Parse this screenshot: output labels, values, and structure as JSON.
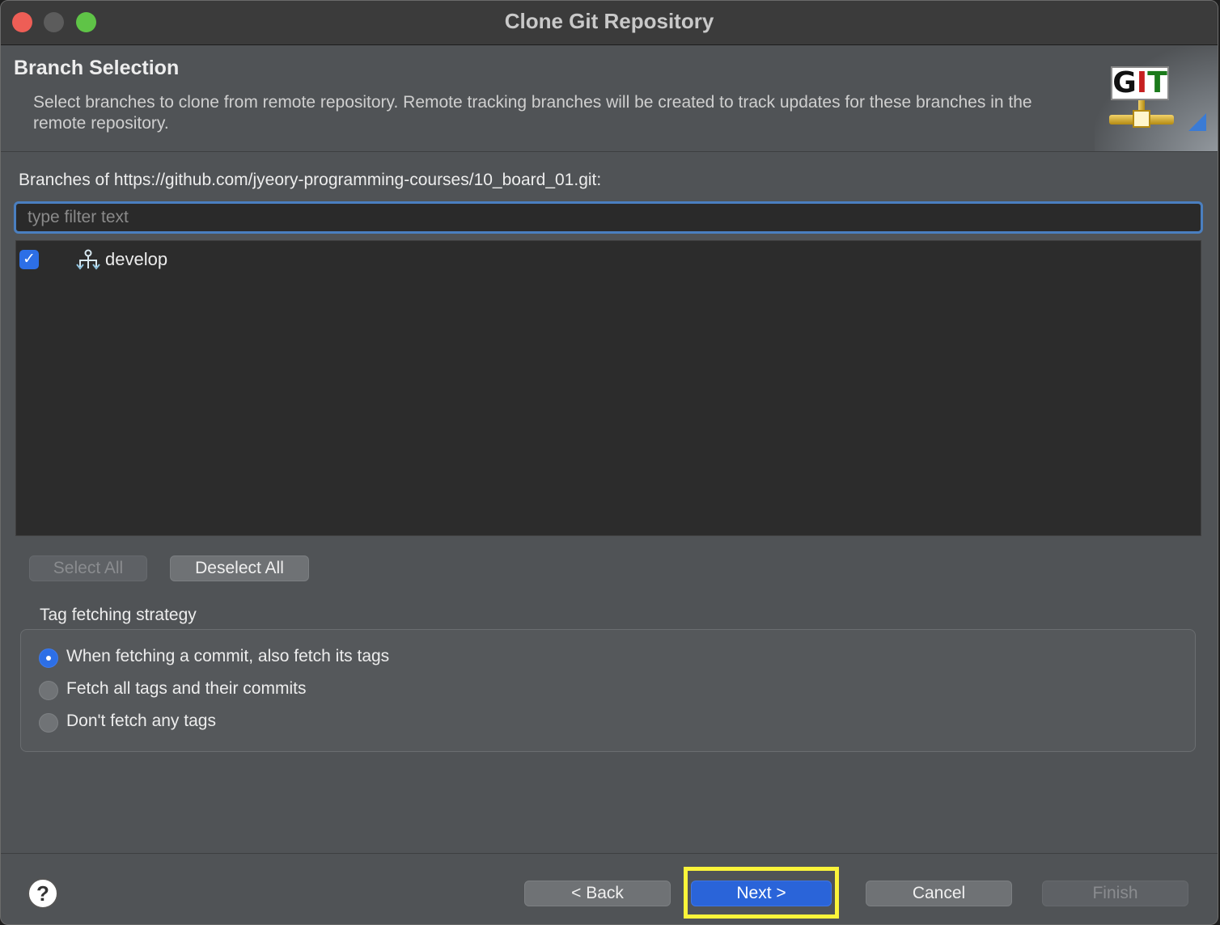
{
  "window": {
    "title": "Clone Git Repository"
  },
  "header": {
    "title": "Branch Selection",
    "description": "Select branches to clone from remote repository. Remote tracking branches will be created to track updates for these branches in the remote repository.",
    "logo_text": "GIT"
  },
  "branches": {
    "label": "Branches of https://github.com/jyeory-programming-courses/10_board_01.git:",
    "filter_placeholder": "type filter text",
    "items": [
      {
        "name": "develop",
        "checked": true,
        "icon": "branch-icon"
      }
    ],
    "select_all_label": "Select All",
    "deselect_all_label": "Deselect All"
  },
  "tag_fetching": {
    "label": "Tag fetching strategy",
    "options": [
      {
        "label": "When fetching a commit, also fetch its tags",
        "selected": true
      },
      {
        "label": "Fetch all tags and their commits",
        "selected": false
      },
      {
        "label": "Don't fetch any tags",
        "selected": false
      }
    ]
  },
  "footer": {
    "help_label": "?",
    "back_label": "< Back",
    "next_label": "Next >",
    "cancel_label": "Cancel",
    "finish_label": "Finish"
  },
  "colors": {
    "accent": "#2d6fe6",
    "highlight": "#fbf43a"
  }
}
